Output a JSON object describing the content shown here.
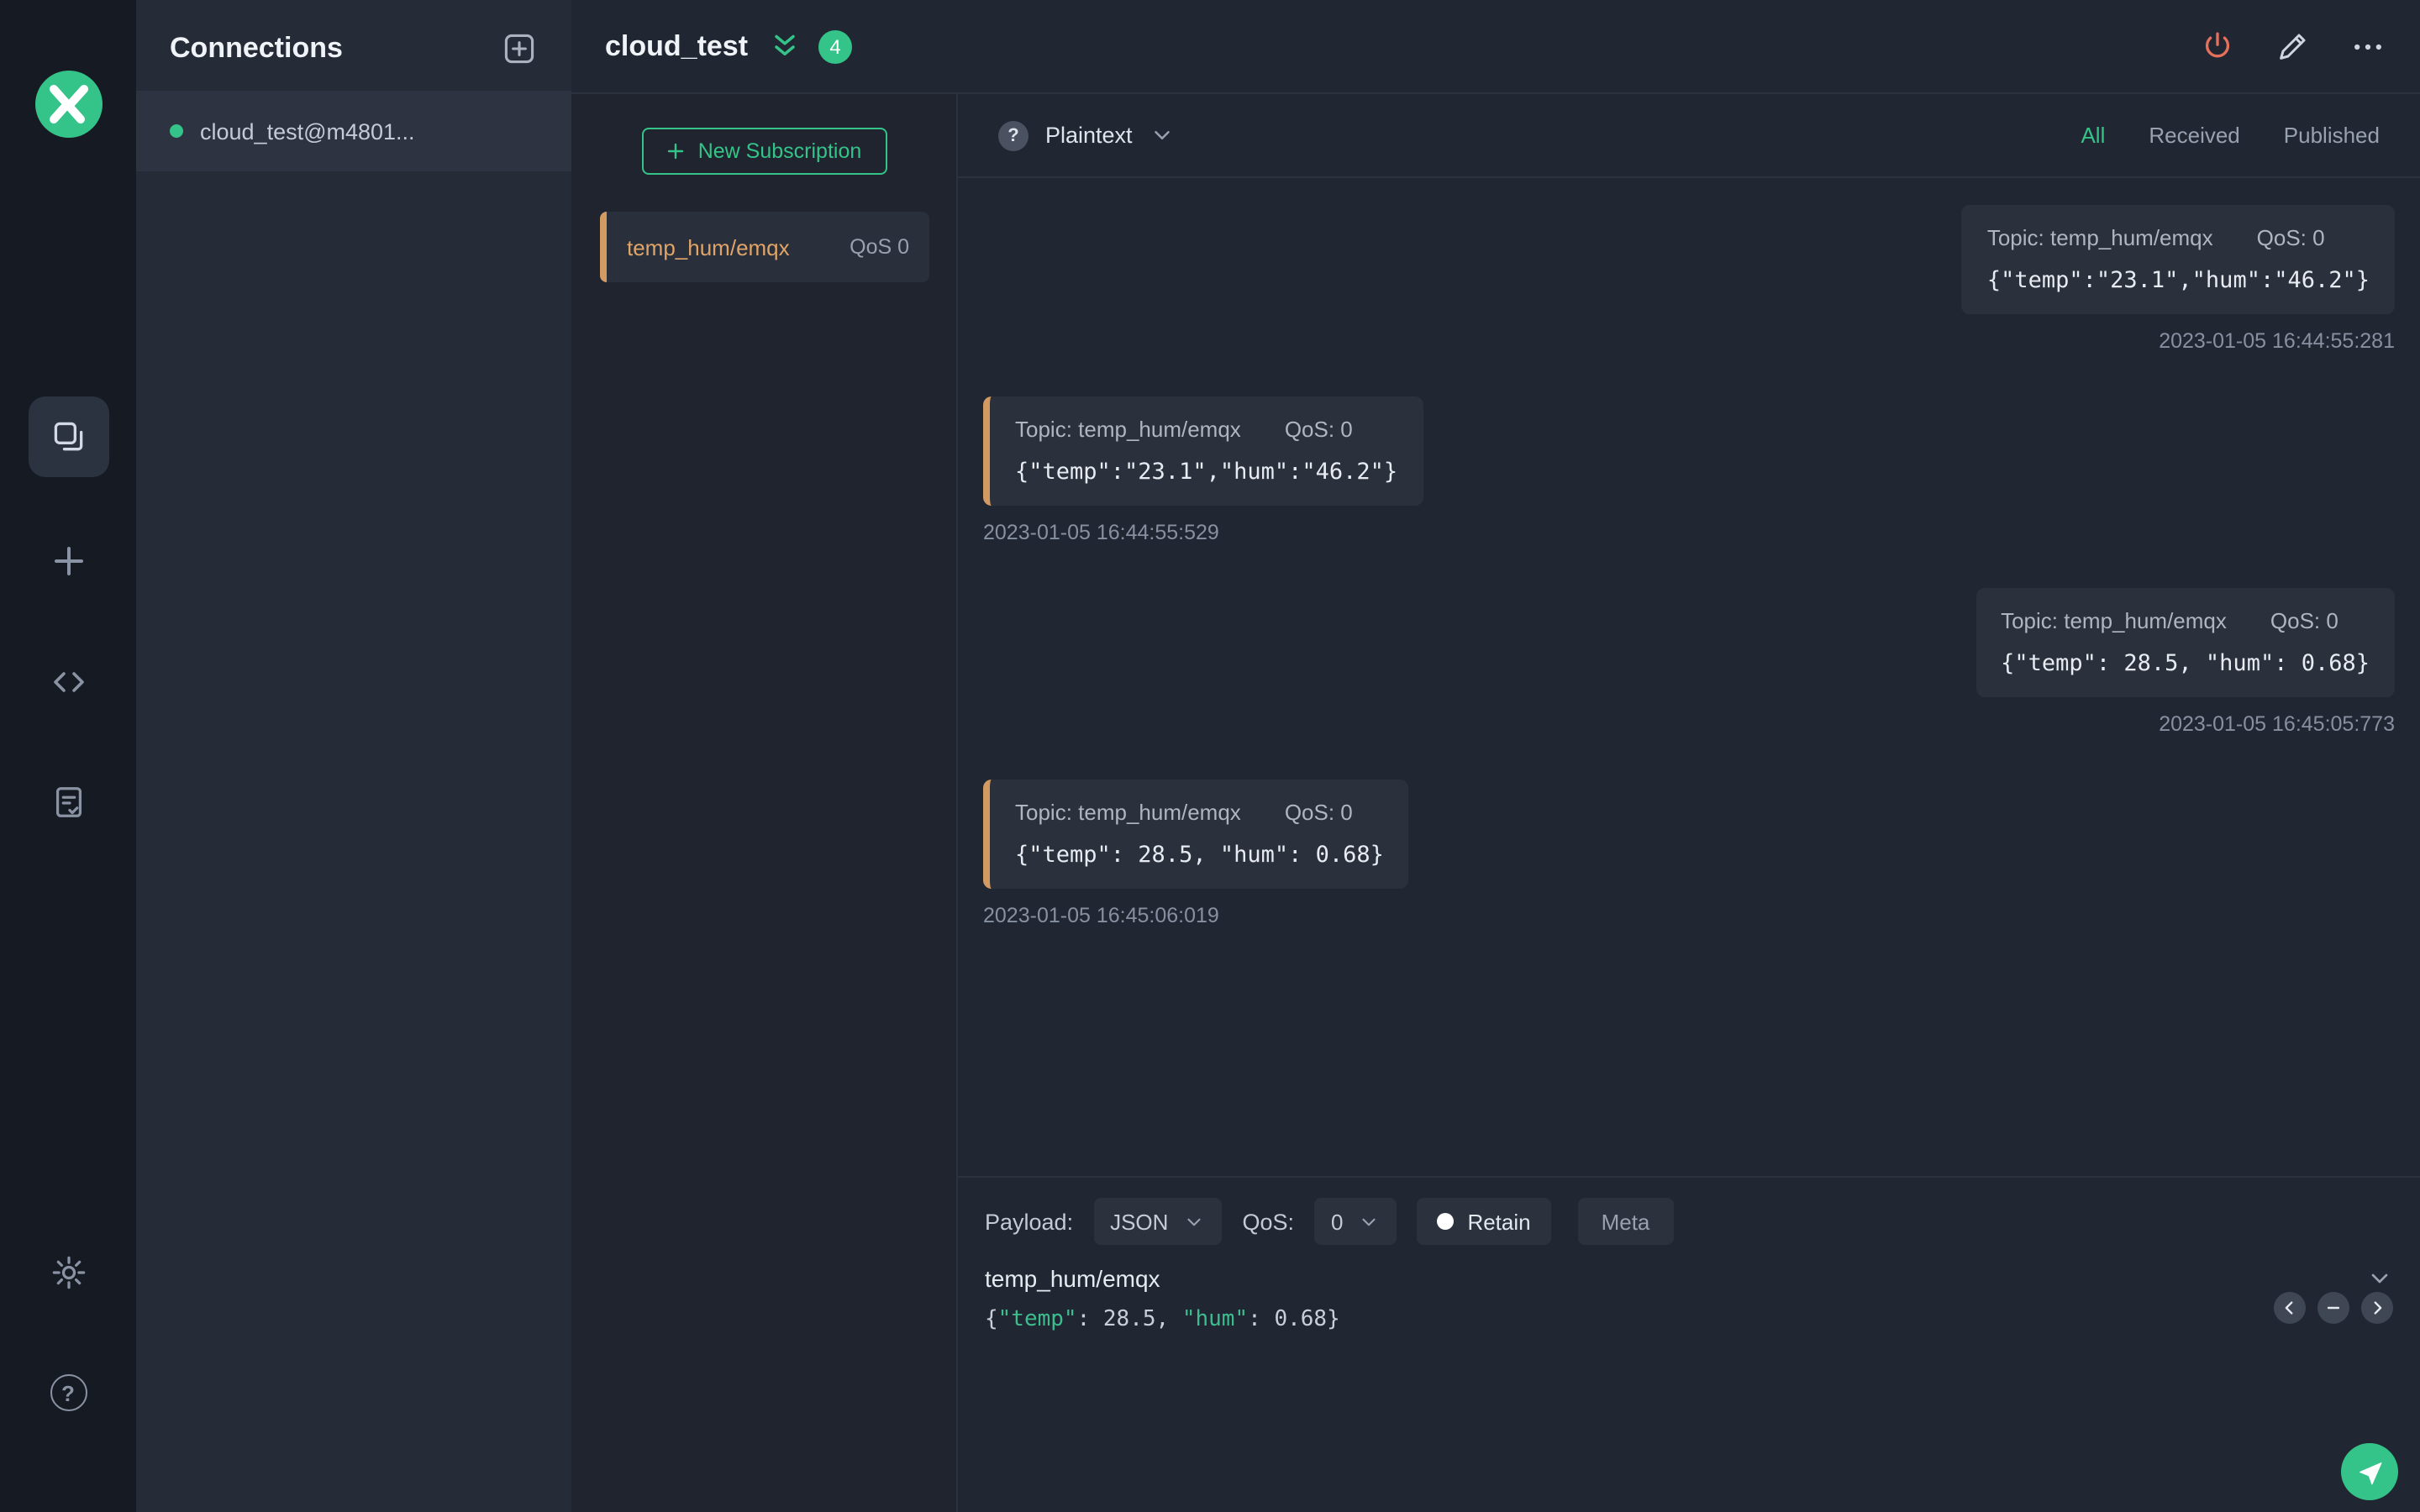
{
  "connections_panel": {
    "title": "Connections",
    "items": [
      {
        "name": "cloud_test@m4801...",
        "connected": true
      }
    ]
  },
  "subscriptions_panel": {
    "new_subscription_label": "New Subscription",
    "items": [
      {
        "topic": "temp_hum/emqx",
        "qos": "QoS 0"
      }
    ]
  },
  "header": {
    "title": "cloud_test",
    "unread_badge": "4"
  },
  "messages_toolbar": {
    "payload_format": "Plaintext",
    "filters": {
      "all": "All",
      "received": "Received",
      "published": "Published"
    },
    "active_filter": "All"
  },
  "messages": [
    {
      "direction": "published",
      "topic": "Topic: temp_hum/emqx",
      "qos": "QoS: 0",
      "payload": "{\"temp\":\"23.1\",\"hum\":\"46.2\"}",
      "time": "2023-01-05 16:44:55:281"
    },
    {
      "direction": "received",
      "topic": "Topic: temp_hum/emqx",
      "qos": "QoS: 0",
      "payload": "{\"temp\":\"23.1\",\"hum\":\"46.2\"}",
      "time": "2023-01-05 16:44:55:529"
    },
    {
      "direction": "published",
      "topic": "Topic: temp_hum/emqx",
      "qos": "QoS: 0",
      "payload": "{\"temp\": 28.5, \"hum\": 0.68}",
      "time": "2023-01-05 16:45:05:773"
    },
    {
      "direction": "received",
      "topic": "Topic: temp_hum/emqx",
      "qos": "QoS: 0",
      "payload": "{\"temp\": 28.5, \"hum\": 0.68}",
      "time": "2023-01-05 16:45:06:019"
    }
  ],
  "publish": {
    "payload_label": "Payload:",
    "payload_format": "JSON",
    "qos_label": "QoS:",
    "qos_value": "0",
    "retain_label": "Retain",
    "meta_label": "Meta",
    "topic_value": "temp_hum/emqx",
    "editor": {
      "t_open": "{",
      "t_key1": "\"temp\"",
      "t_sep1": ": ",
      "t_val1": "28.5",
      "t_comma": ", ",
      "t_key2": "\"hum\"",
      "t_sep2": ": ",
      "t_val2": "0.68",
      "t_close": "}"
    }
  },
  "colors": {
    "accent_green": "#34c388",
    "subscription_orange": "#d39a62",
    "danger_red": "#e5705c"
  }
}
